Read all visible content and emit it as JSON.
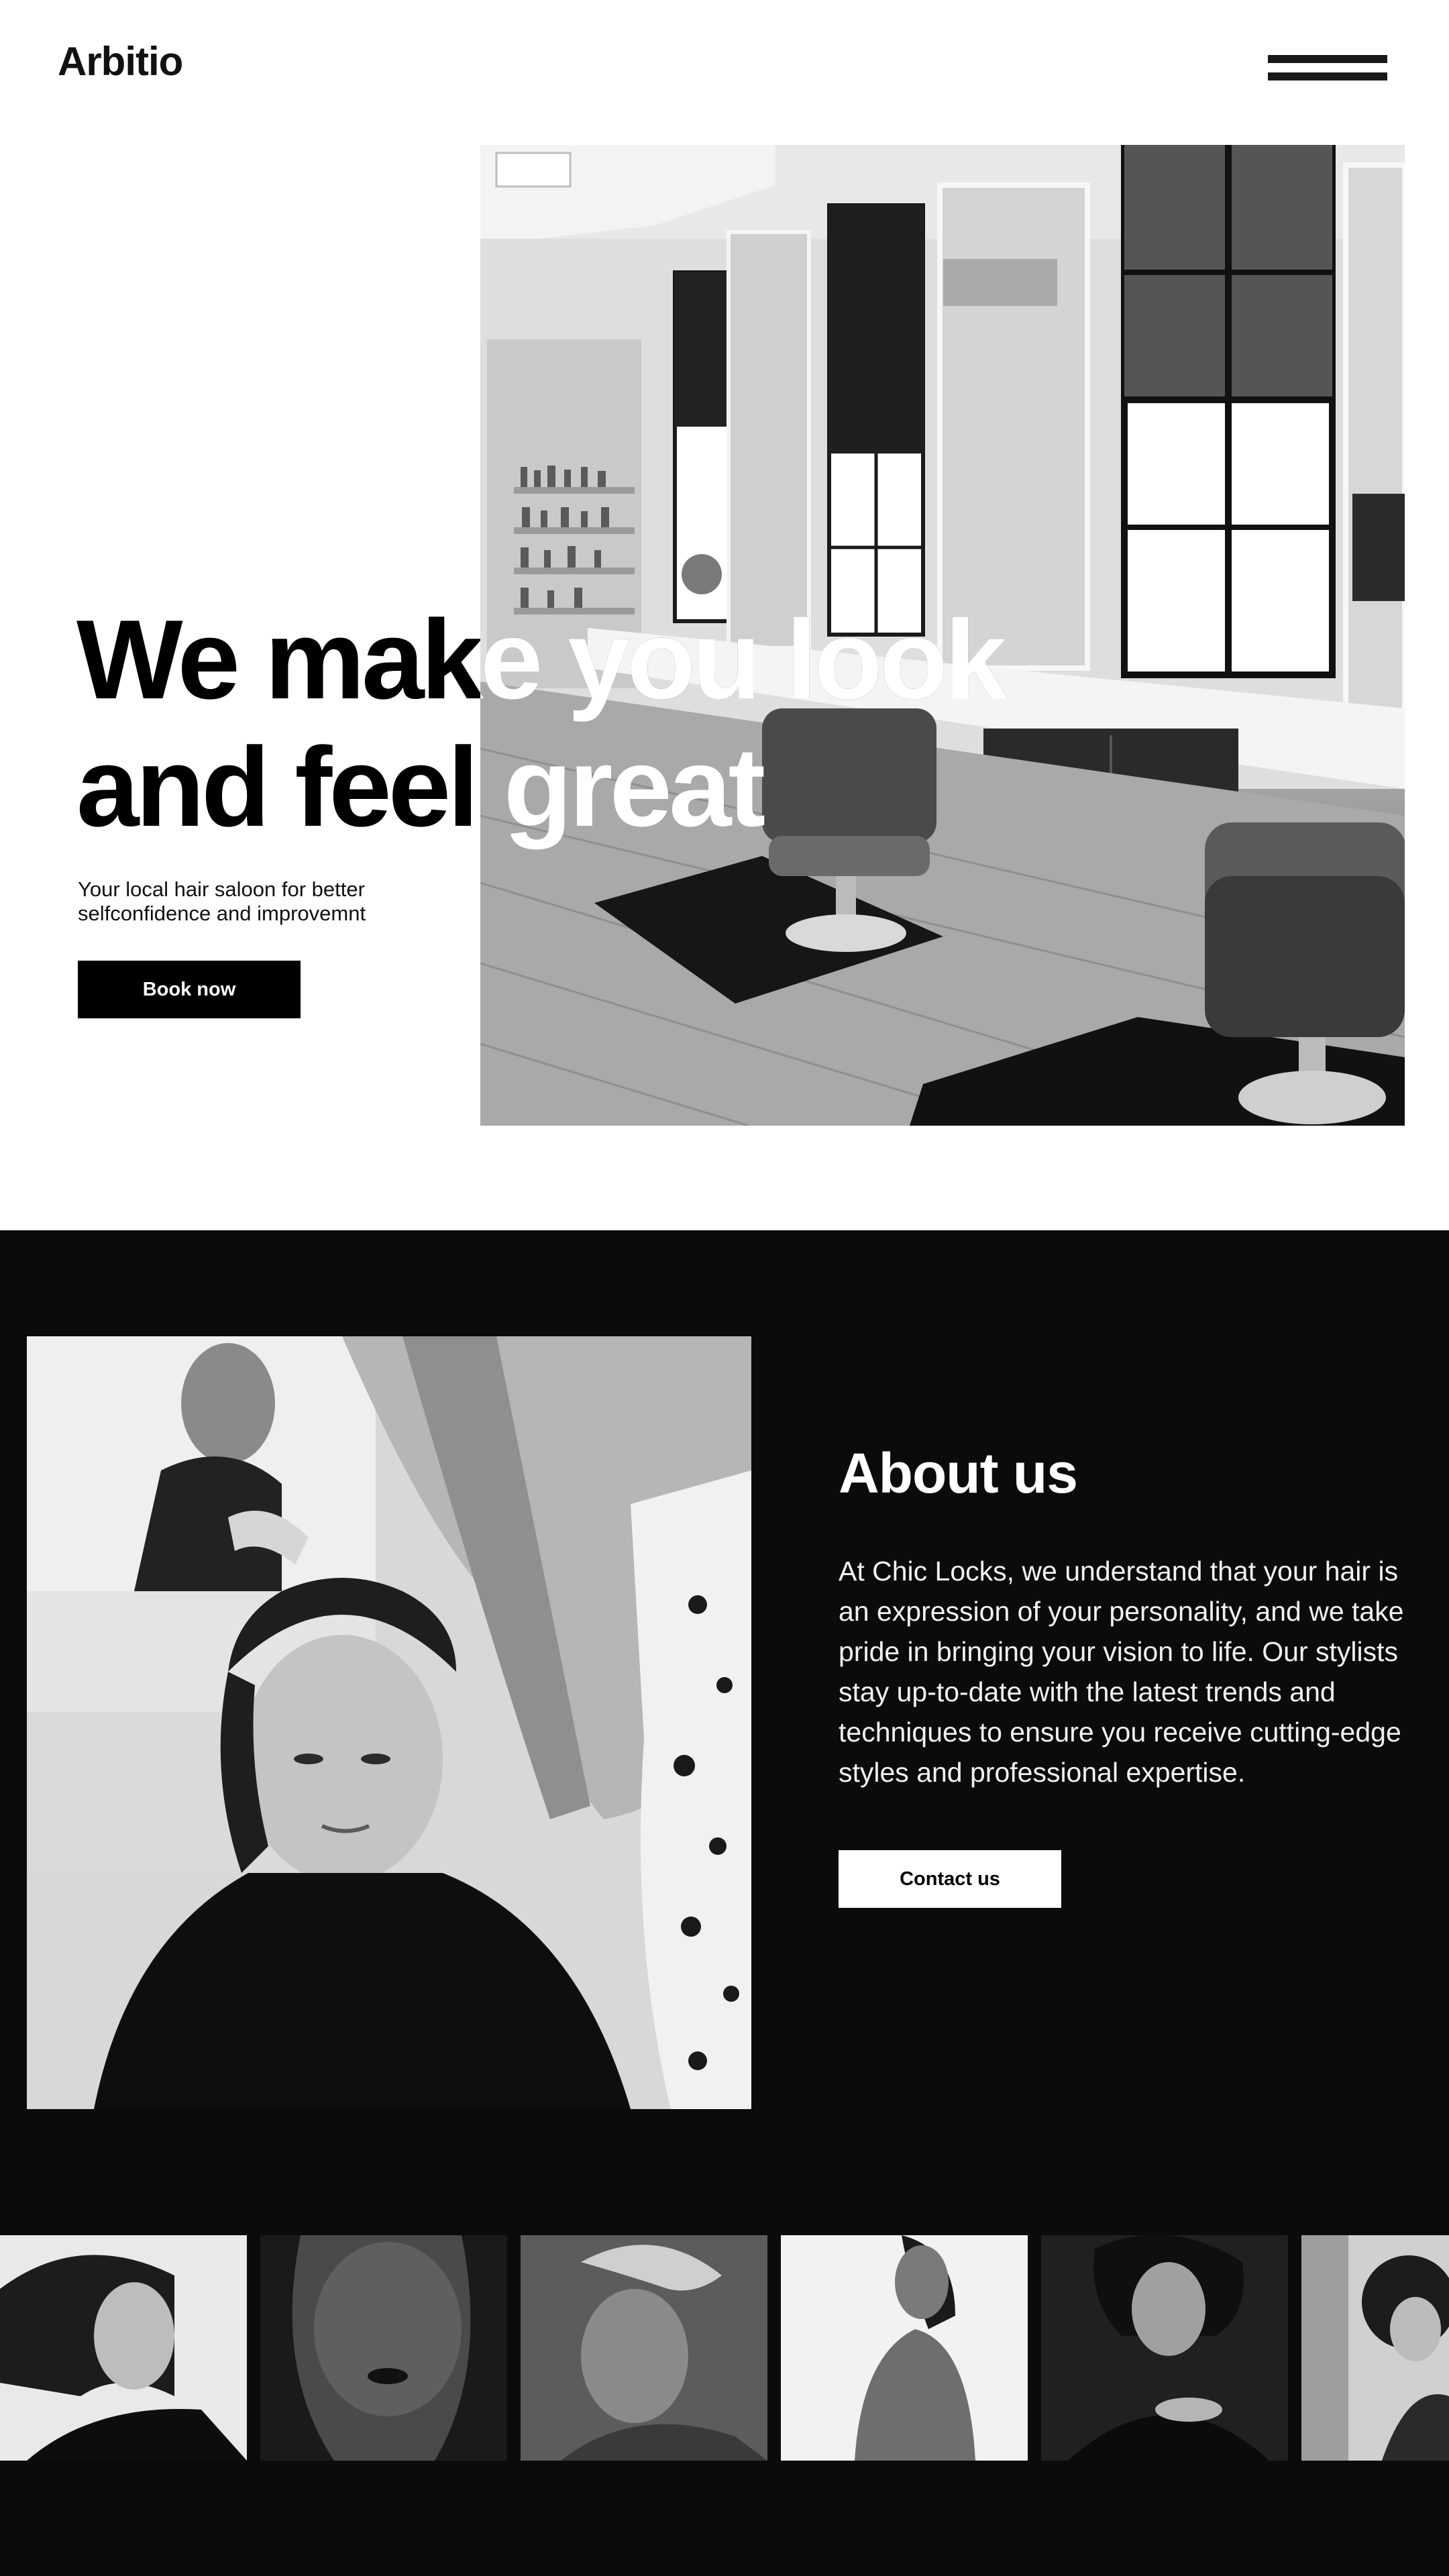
{
  "header": {
    "logo": "Arbitio",
    "menu_icon": "hamburger-menu-icon"
  },
  "hero": {
    "title_line1": "We make you look",
    "title_line2": "and feel great",
    "subtitle_line1": "Your local hair saloon for better",
    "subtitle_line2": "selfconfidence and improvemnt",
    "cta_label": "Book now",
    "image_subject": "salon-interior-photo"
  },
  "about": {
    "title": "About us",
    "text": "At Chic Locks, we understand that your hair is an expression of your personality, and we take pride in bringing your vision to life. Our stylists stay up-to-date with the latest trends and techniques to ensure you receive cutting-edge styles and professional expertise.",
    "cta_label": "Contact us",
    "image_subject": "stylist-with-client-photo"
  },
  "gallery": {
    "items": [
      {
        "subject": "woman-windswept-hair-portrait"
      },
      {
        "subject": "woman-hair-over-face-portrait"
      },
      {
        "subject": "short-hair-profile-portrait"
      },
      {
        "subject": "woman-crouching-portrait"
      },
      {
        "subject": "man-curly-hair-portrait"
      },
      {
        "subject": "woman-curly-hair-street-portrait"
      }
    ]
  },
  "colors": {
    "background": "#ffffff",
    "dark_section": "#0b0b0b",
    "primary_button": "#000000",
    "secondary_button": "#ffffff",
    "text_dark": "#000000",
    "text_light": "#ffffff"
  }
}
